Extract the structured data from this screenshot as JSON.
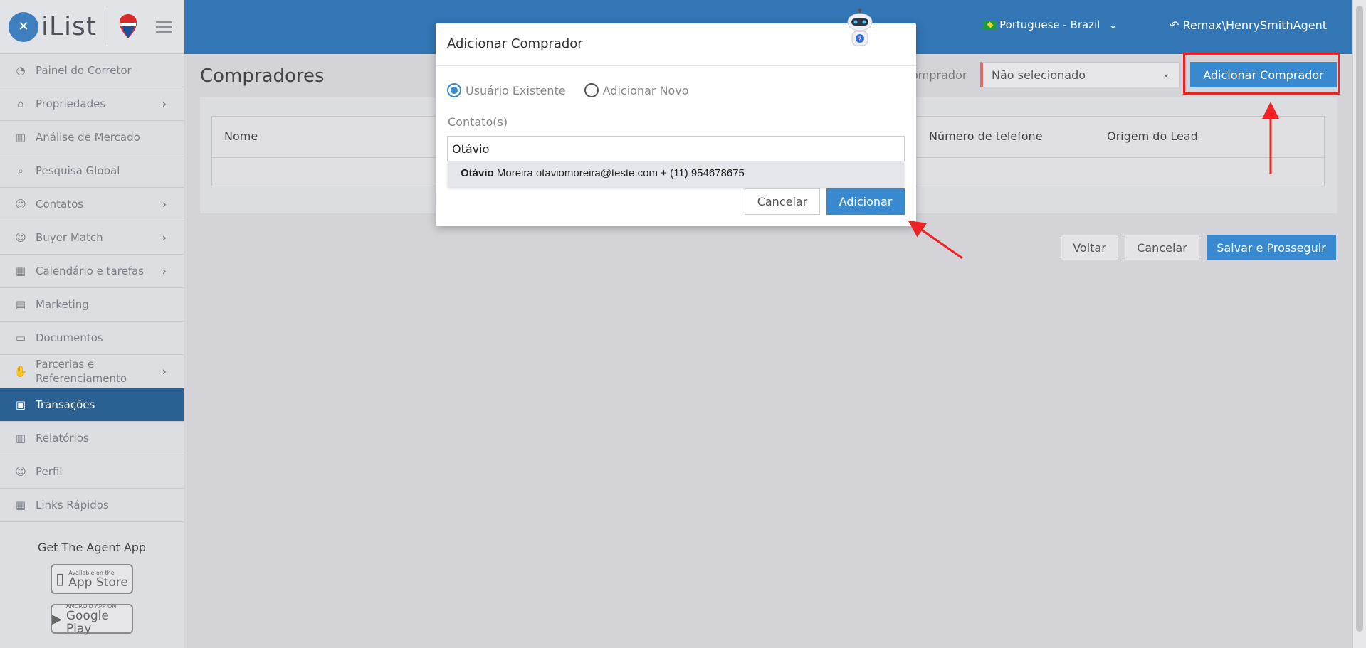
{
  "app": {
    "logo_text": "iList"
  },
  "sidebar": {
    "items": [
      {
        "label": "Painel do Corretor",
        "icon": "dashboard-icon",
        "chevron": false
      },
      {
        "label": "Propriedades",
        "icon": "home-icon",
        "chevron": true
      },
      {
        "label": "Análise de Mercado",
        "icon": "bar-chart-icon",
        "chevron": false
      },
      {
        "label": "Pesquisa Global",
        "icon": "search-icon",
        "chevron": false
      },
      {
        "label": "Contatos",
        "icon": "contacts-icon",
        "chevron": true
      },
      {
        "label": "Buyer Match",
        "icon": "user-icon",
        "chevron": true
      },
      {
        "label": "Calendário e tarefas",
        "icon": "calendar-icon",
        "chevron": true
      },
      {
        "label": "Marketing",
        "icon": "book-icon",
        "chevron": false
      },
      {
        "label": "Documentos",
        "icon": "folder-icon",
        "chevron": false
      },
      {
        "label": "Parcerias e Referenciamento",
        "icon": "handshake-icon",
        "chevron": true
      },
      {
        "label": "Transações",
        "icon": "briefcase-icon",
        "chevron": false,
        "active": true
      },
      {
        "label": "Relatórios",
        "icon": "bar-chart-icon",
        "chevron": false
      },
      {
        "label": "Perfil",
        "icon": "user-icon",
        "chevron": false
      },
      {
        "label": "Links Rápidos",
        "icon": "store-icon",
        "chevron": false
      }
    ],
    "get_app": "Get The Agent App",
    "app_store": {
      "small": "Available on the",
      "big": "App Store"
    },
    "google_play": {
      "small": "ANDROID APP ON",
      "big": "Google Play"
    }
  },
  "topbar": {
    "language": "Portuguese - Brazil",
    "user": "Remax\\HenrySmithAgent"
  },
  "main": {
    "title": "Compradores",
    "comprador_label": "omprador",
    "select_value": "Não selecionado",
    "add_button": "Adicionar Comprador",
    "table_headers": {
      "nome": "Nome",
      "telefone": "Número de telefone",
      "origem": "Origem do Lead"
    },
    "buttons": {
      "voltar": "Voltar",
      "cancelar": "Cancelar",
      "salvar": "Salvar e Prosseguir"
    }
  },
  "modal": {
    "title": "Adicionar Comprador",
    "radio_existing": "Usuário Existente",
    "radio_new": "Adicionar Novo",
    "contact_label": "Contato(s)",
    "contact_value": "Otávio",
    "suggestion": {
      "bold": "Otávio",
      "rest": " Moreira otaviomoreira@teste.com + (11) 954678675"
    },
    "cancel": "Cancelar",
    "add": "Adicionar"
  },
  "colors": {
    "primary": "#3889cf",
    "topbar": "#3276b5",
    "active_nav": "#2a6192",
    "highlight": "#ee2222"
  }
}
